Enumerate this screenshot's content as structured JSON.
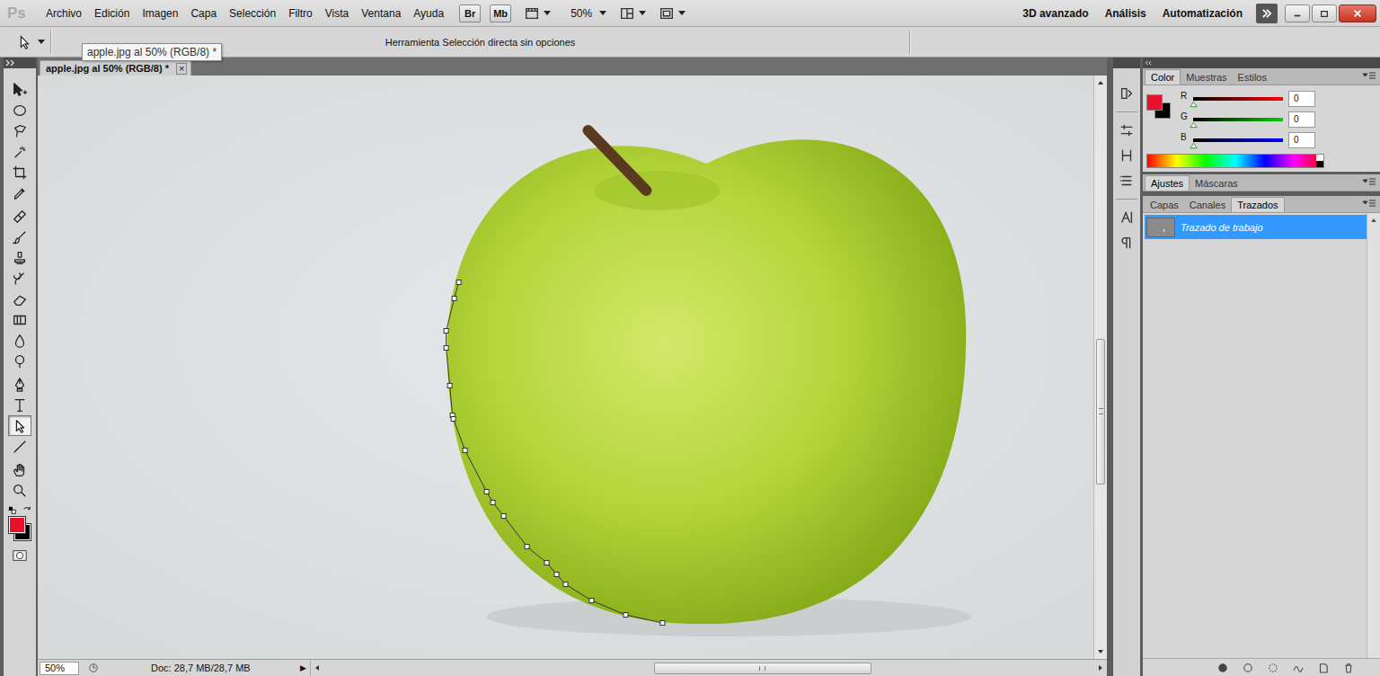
{
  "app": {
    "logo": "Ps"
  },
  "menu": [
    "Archivo",
    "Edición",
    "Imagen",
    "Capa",
    "Selección",
    "Filtro",
    "Vista",
    "Ventana",
    "Ayuda"
  ],
  "app_bar": {
    "bridge": "Br",
    "mini_bridge": "Mb",
    "zoom": "50%"
  },
  "workspaces": [
    "3D avanzado",
    "Análisis",
    "Automatización"
  ],
  "options_bar": {
    "hint": "Herramienta Selección directa sin opciones"
  },
  "tooltip": "apple.jpg al 50% (RGB/8) *",
  "document": {
    "tab": "apple.jpg al 50% (RGB/8) *",
    "close": "×",
    "zoom": "50%",
    "info": "Doc: 28,7 MB/28,7 MB",
    "info_arrow": "▶"
  },
  "tools": [
    {
      "kind": "move",
      "selected": false
    },
    {
      "kind": "marquee",
      "selected": false
    },
    {
      "kind": "lasso",
      "selected": false
    },
    {
      "kind": "wand",
      "selected": false
    },
    {
      "kind": "crop",
      "selected": false
    },
    {
      "kind": "eyedropper",
      "selected": false
    },
    {
      "kind": "healing",
      "selected": false
    },
    {
      "kind": "brush",
      "selected": false
    },
    {
      "kind": "stamp",
      "selected": false
    },
    {
      "kind": "history",
      "selected": false
    },
    {
      "kind": "eraser",
      "selected": false
    },
    {
      "kind": "gradient",
      "selected": false
    },
    {
      "kind": "blur",
      "selected": false
    },
    {
      "kind": "dodge",
      "selected": false
    },
    {
      "kind": "pen",
      "selected": false
    },
    {
      "kind": "type",
      "selected": false
    },
    {
      "kind": "direct",
      "selected": true
    },
    {
      "kind": "line",
      "selected": false
    },
    {
      "kind": "hand",
      "selected": false
    },
    {
      "kind": "zoom",
      "selected": false
    }
  ],
  "colors": {
    "foreground": "#e8102a",
    "background": "#000000"
  },
  "color_panel": {
    "tabs": [
      {
        "label": "Color",
        "selected": true
      },
      {
        "label": "Muestras",
        "selected": false
      },
      {
        "label": "Estilos",
        "selected": false
      }
    ],
    "channels": [
      {
        "label": "R",
        "value": "0",
        "level": 0,
        "color": "#ff0000"
      },
      {
        "label": "G",
        "value": "0",
        "level": 0,
        "color": "#00d000"
      },
      {
        "label": "B",
        "value": "0",
        "level": 0,
        "color": "#0000ff"
      }
    ]
  },
  "adjust_panel": {
    "tabs": [
      {
        "label": "Ajustes",
        "selected": true
      },
      {
        "label": "Máscaras",
        "selected": false
      }
    ]
  },
  "paths_panel": {
    "tabs": [
      {
        "label": "Capas",
        "selected": false
      },
      {
        "label": "Canales",
        "selected": false
      },
      {
        "label": "Trazados",
        "selected": true
      }
    ],
    "paths": [
      {
        "name": "Trazado de trabajo",
        "selected": true
      }
    ]
  }
}
